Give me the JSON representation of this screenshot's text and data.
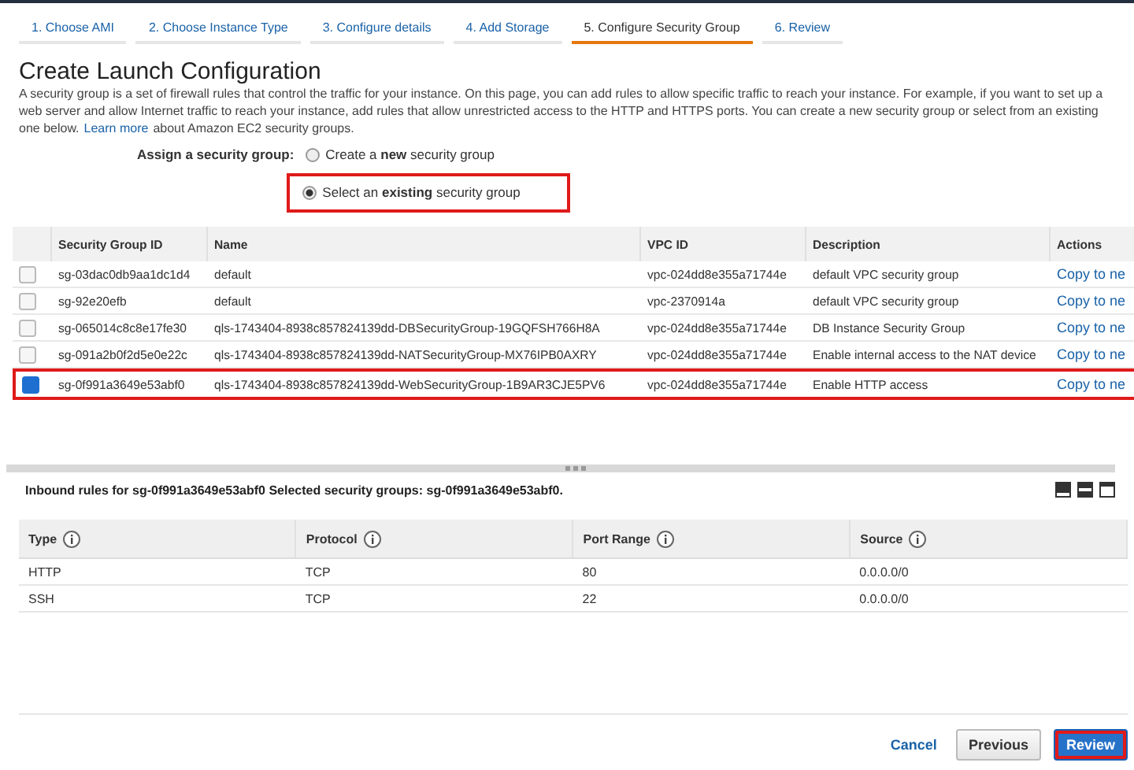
{
  "tabs": [
    {
      "label": "1. Choose AMI",
      "selected": false
    },
    {
      "label": "2. Choose Instance Type",
      "selected": false
    },
    {
      "label": "3. Configure details",
      "selected": false
    },
    {
      "label": "4. Add Storage",
      "selected": false
    },
    {
      "label": "5. Configure Security Group",
      "selected": true
    },
    {
      "label": "6. Review",
      "selected": false
    }
  ],
  "title": "Create Launch Configuration",
  "intro": {
    "lines": [
      "A security group is a set of firewall rules that control the traffic for your instance. On this page, you can add rules to allow specific traffic to reach your instance. For example, if you want to set up a",
      "web server and allow Internet traffic to reach your instance, add rules that allow unrestricted access to the HTTP and HTTPS ports. You can create a new security group or select from an existing"
    ],
    "lead": "one below.",
    "link": "Learn more",
    "tail": "about Amazon EC2 security groups."
  },
  "assign": {
    "label": "Assign a security group:",
    "options": [
      {
        "label": "Create a **new** security group",
        "selected": false,
        "highlighted": false
      },
      {
        "label": "Select an **existing** security group",
        "selected": true,
        "highlighted": true
      }
    ]
  },
  "groups": {
    "columns": [
      "Security Group ID",
      "Name",
      "VPC ID",
      "Description",
      "Actions"
    ],
    "rows": [
      {
        "id": "sg-03dac0db9aa1dc1d4",
        "name": "default",
        "vpc": "vpc-024dd8e355a71744e",
        "description": "default VPC security group",
        "action": "Copy to ne",
        "checked": false,
        "highlighted": false
      },
      {
        "id": "sg-92e20efb",
        "name": "default",
        "vpc": "vpc-2370914a",
        "description": "default VPC security group",
        "action": "Copy to ne",
        "checked": false,
        "highlighted": false
      },
      {
        "id": "sg-065014c8c8e17fe30",
        "name": "qls-1743404-8938c857824139dd-DBSecurityGroup-19GQFSH766H8A",
        "vpc": "vpc-024dd8e355a71744e",
        "description": "DB Instance Security Group",
        "action": "Copy to ne",
        "checked": false,
        "highlighted": false
      },
      {
        "id": "sg-091a2b0f2d5e0e22c",
        "name": "qls-1743404-8938c857824139dd-NATSecurityGroup-MX76IPB0AXRY",
        "vpc": "vpc-024dd8e355a71744e",
        "description": "Enable internal access to the NAT device",
        "action": "Copy to ne",
        "checked": false,
        "highlighted": false
      },
      {
        "id": "sg-0f991a3649e53abf0",
        "name": "qls-1743404-8938c857824139dd-WebSecurityGroup-1B9AR3CJE5PV6",
        "vpc": "vpc-024dd8e355a71744e",
        "description": "Enable HTTP access",
        "action": "Copy to ne",
        "checked": true,
        "highlighted": true
      }
    ]
  },
  "inbound": {
    "heading": "Inbound rules for sg-0f991a3649e53abf0 Selected security groups: sg-0f991a3649e53abf0.",
    "columns": [
      "Type",
      "Protocol",
      "Port Range",
      "Source"
    ],
    "rows": [
      [
        "HTTP",
        "TCP",
        "80",
        "0.0.0.0/0"
      ],
      [
        "SSH",
        "TCP",
        "22",
        "0.0.0.0/0"
      ]
    ]
  },
  "footer": {
    "cancel": "Cancel",
    "previous": "Previous",
    "review": "Review",
    "review_highlighted": true
  }
}
